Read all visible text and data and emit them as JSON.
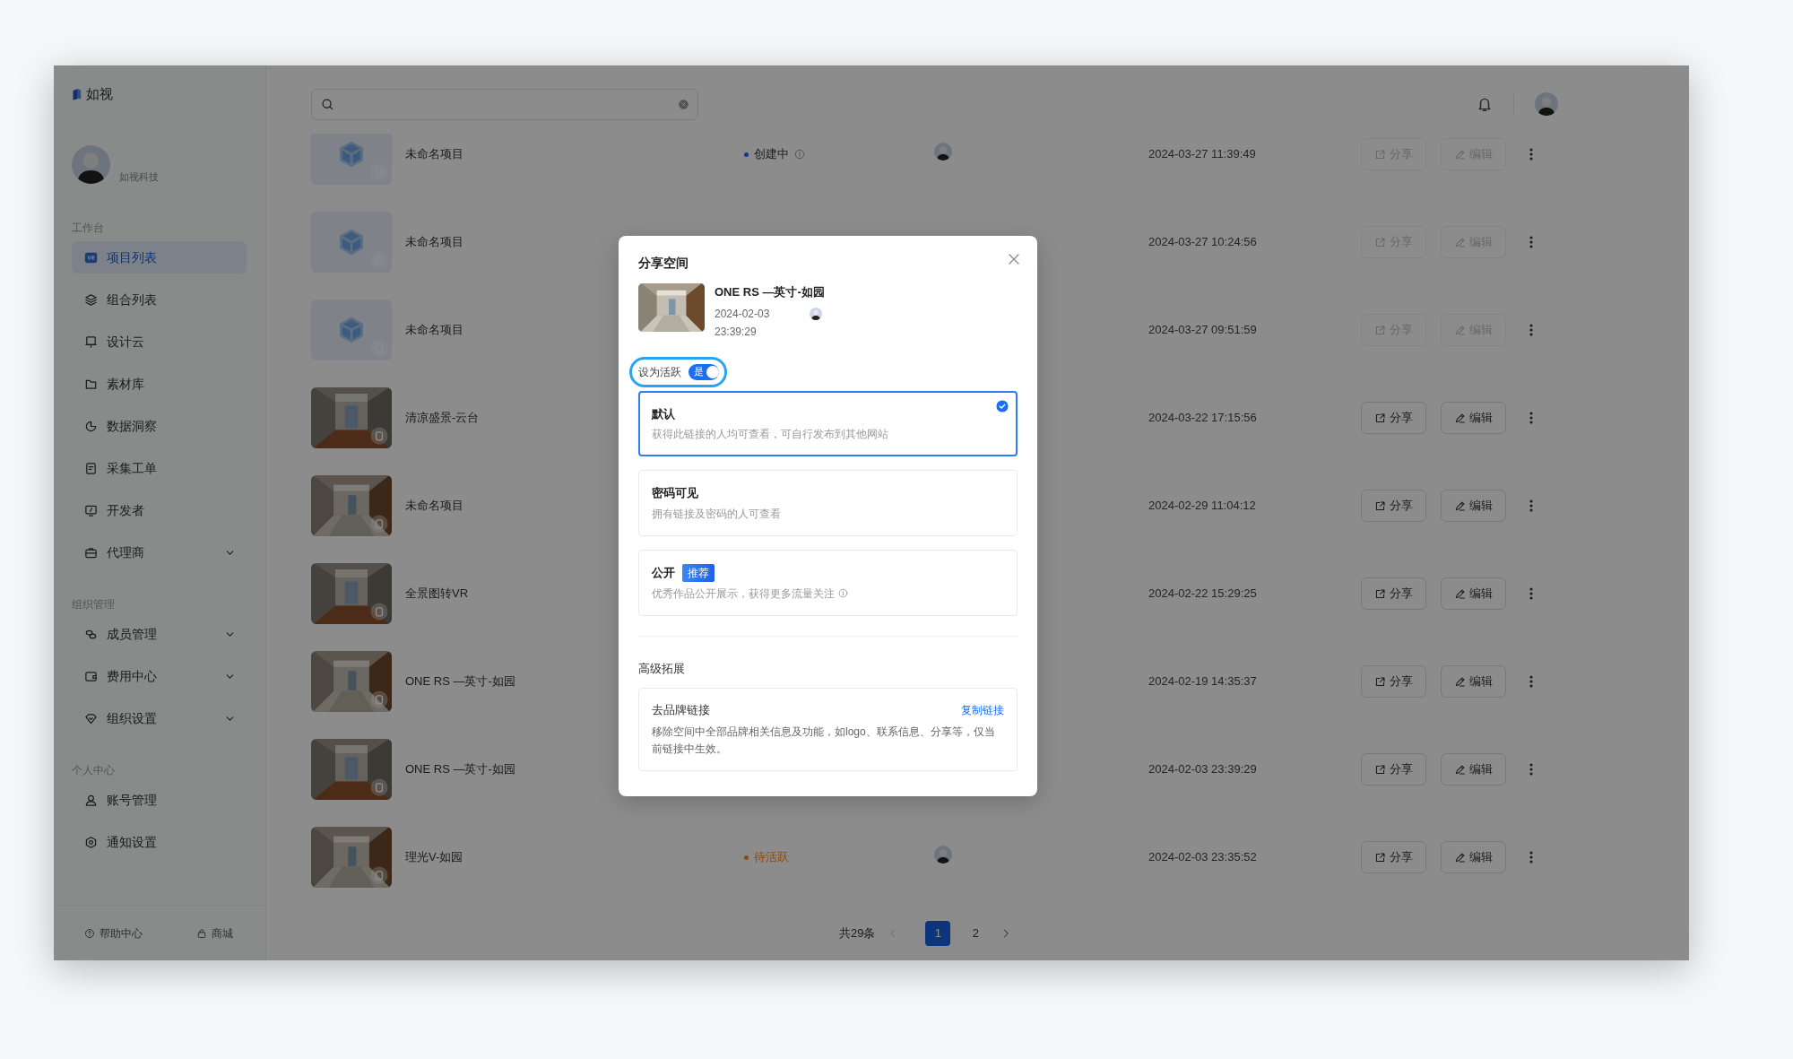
{
  "sidebar": {
    "logo": "如视",
    "user": {
      "name": "如视科技"
    },
    "sections": [
      {
        "title": "工作台",
        "items": [
          {
            "label": "项目列表",
            "selected": true,
            "expandable": false
          },
          {
            "label": "组合列表",
            "selected": false,
            "expandable": false
          },
          {
            "label": "设计云",
            "selected": false,
            "expandable": false
          },
          {
            "label": "素材库",
            "selected": false,
            "expandable": false
          },
          {
            "label": "数据洞察",
            "selected": false,
            "expandable": false
          },
          {
            "label": "采集工单",
            "selected": false,
            "expandable": false
          },
          {
            "label": "开发者",
            "selected": false,
            "expandable": false
          },
          {
            "label": "代理商",
            "selected": false,
            "expandable": true
          }
        ]
      },
      {
        "title": "组织管理",
        "items": [
          {
            "label": "成员管理",
            "selected": false,
            "expandable": true
          },
          {
            "label": "费用中心",
            "selected": false,
            "expandable": true
          },
          {
            "label": "组织设置",
            "selected": false,
            "expandable": true
          }
        ]
      },
      {
        "title": "个人中心",
        "items": [
          {
            "label": "账号管理",
            "selected": false,
            "expandable": false
          },
          {
            "label": "通知设置",
            "selected": false,
            "expandable": false
          }
        ]
      }
    ],
    "footer": [
      {
        "label": "帮助中心"
      },
      {
        "label": "商城"
      }
    ]
  },
  "projects": [
    {
      "thumbnail": {
        "kind": "placeholder"
      },
      "name": "未命名项目",
      "status": {
        "label": "创建中",
        "kind": "creating"
      },
      "owner_avatar": true,
      "date": "2024-03-27 11:39:49",
      "share": "分享",
      "edit": "编辑",
      "disabled": true
    },
    {
      "thumbnail": {
        "kind": "placeholder"
      },
      "name": "未命名项目",
      "date": "2024-03-27 10:24:56",
      "share": "分享",
      "edit": "编辑",
      "disabled": true
    },
    {
      "thumbnail": {
        "kind": "placeholder"
      },
      "name": "未命名项目",
      "date": "2024-03-27 09:51:59",
      "share": "分享",
      "edit": "编辑",
      "disabled": true
    },
    {
      "name": "清凉盛景-云台",
      "date": "2024-03-22 17:15:56",
      "share": "分享",
      "edit": "编辑",
      "disabled": false
    },
    {
      "name": "未命名项目",
      "date": "2024-02-29 11:04:12",
      "share": "分享",
      "edit": "编辑",
      "disabled": false
    },
    {
      "name": "全景图转VR",
      "date": "2024-02-22 15:29:25",
      "share": "分享",
      "edit": "编辑",
      "disabled": false
    },
    {
      "name": "ONE RS —英寸-如园",
      "date": "2024-02-19 14:35:37",
      "share": "分享",
      "edit": "编辑",
      "disabled": false
    },
    {
      "name": "ONE RS —英寸-如园",
      "date": "2024-02-03 23:39:29",
      "share": "分享",
      "edit": "编辑",
      "disabled": false
    },
    {
      "name": "理光V-如园",
      "status": {
        "label": "待活跃",
        "kind": "pending"
      },
      "owner_avatar": true,
      "date": "2024-02-03 23:35:52",
      "share": "分享",
      "edit": "编辑",
      "disabled": false
    }
  ],
  "pagination": {
    "total": "共29条",
    "pages": [
      {
        "label": "1",
        "selected": true
      },
      {
        "label": "2",
        "selected": false
      }
    ]
  },
  "dialog": {
    "title": "分享空间",
    "project": {
      "name": "ONE RS —英寸-如园",
      "datetime": "2024-02-03 23:39:29"
    },
    "active_toggle": {
      "label": "设为活跃",
      "value": "是",
      "on": true,
      "focused": true
    },
    "options": [
      {
        "title": "默认",
        "description": "获得此链接的人均可查看，可自行发布到其他网站",
        "selected": true
      },
      {
        "title": "密码可见",
        "description": "拥有链接及密码的人可查看",
        "selected": false
      },
      {
        "title": "公开",
        "tag": "推荐",
        "description": "优秀作品公开展示，获得更多流量关注",
        "info": true,
        "selected": false
      }
    ],
    "advanced": {
      "title": "高级拓展",
      "item": {
        "title": "去品牌链接",
        "action": "复制链接",
        "description": "移除空间中全部品牌相关信息及功能，如logo、联系信息、分享等，仅当前链接中生效。"
      }
    }
  }
}
